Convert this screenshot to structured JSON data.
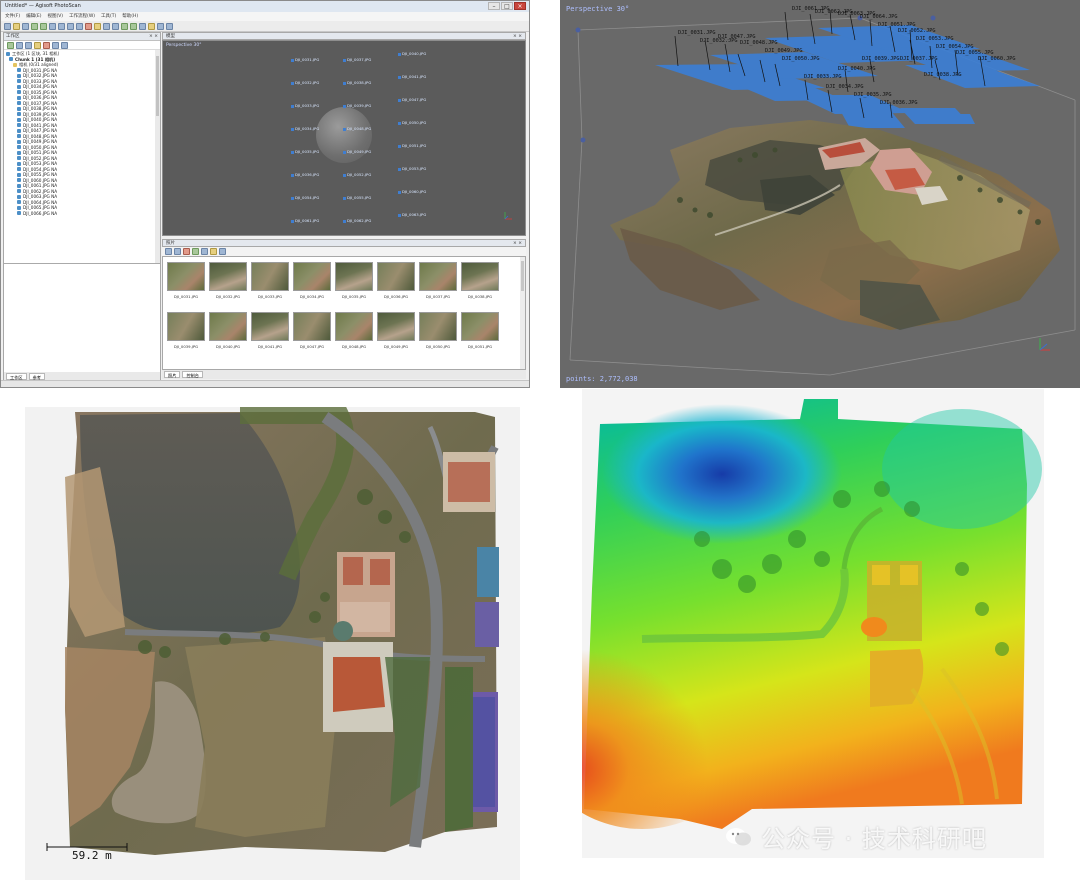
{
  "photoscan": {
    "title": "Untitled* — Agisoft PhotoScan",
    "menu": [
      "文件(F)",
      "编辑(E)",
      "视图(V)",
      "工作流程(W)",
      "工具(T)",
      "帮助(H)"
    ],
    "workspace": {
      "title": "工作区",
      "root": "工作区 (1 区块, 31 相机)",
      "chunk": "Chunk 1 (31 相机)",
      "group": "相机 (0/31 aligned)",
      "cameras": [
        "DJI_0031.JPG NA",
        "DJI_0032.JPG NA",
        "DJI_0033.JPG NA",
        "DJI_0034.JPG NA",
        "DJI_0035.JPG NA",
        "DJI_0036.JPG NA",
        "DJI_0037.JPG NA",
        "DJI_0038.JPG NA",
        "DJI_0039.JPG NA",
        "DJI_0040.JPG NA",
        "DJI_0041.JPG NA",
        "DJI_0047.JPG NA",
        "DJI_0048.JPG NA",
        "DJI_0049.JPG NA",
        "DJI_0050.JPG NA",
        "DJI_0051.JPG NA",
        "DJI_0052.JPG NA",
        "DJI_0053.JPG NA",
        "DJI_0054.JPG NA",
        "DJI_0055.JPG NA",
        "DJI_0060.JPG NA",
        "DJI_0061.JPG NA",
        "DJI_0062.JPG NA",
        "DJI_0063.JPG NA",
        "DJI_0064.JPG NA",
        "DJI_0065.JPG NA",
        "DJI_0066.JPG NA"
      ],
      "tabs": [
        "工作区",
        "参考"
      ]
    },
    "model": {
      "title": "模型",
      "perspective": "Perspective 30°",
      "cams": [
        "DJI_0031.JPG",
        "DJI_0037.JPG",
        "DJI_0040.JPG",
        "DJI_0032.JPG",
        "DJI_0038.JPG",
        "DJI_0041.JPG",
        "DJI_0033.JPG",
        "DJI_0039.JPG",
        "DJI_0047.JPG",
        "DJI_0034.JPG",
        "DJI_0048.JPG",
        "DJI_0050.JPG",
        "DJI_0035.JPG",
        "DJI_0049.JPG",
        "DJI_0051.JPG",
        "DJI_0036.JPG",
        "DJI_0052.JPG",
        "DJI_0053.JPG",
        "DJI_0054.JPG",
        "DJI_0055.JPG",
        "DJI_0060.JPG",
        "DJI_0061.JPG",
        "DJI_0062.JPG",
        "DJI_0063.JPG"
      ]
    },
    "photos": {
      "title": "照片",
      "labels": [
        "DJI_0031.JPG",
        "DJI_0032.JPG",
        "DJI_0033.JPG",
        "DJI_0034.JPG",
        "DJI_0035.JPG",
        "DJI_0036.JPG",
        "DJI_0037.JPG",
        "DJI_0038.JPG",
        "DJI_0039.JPG",
        "DJI_0040.JPG",
        "DJI_0041.JPG",
        "DJI_0047.JPG",
        "DJI_0048.JPG",
        "DJI_0049.JPG",
        "DJI_0050.JPG",
        "DJI_0051.JPG"
      ],
      "tabs": [
        "照片",
        "控制台"
      ]
    }
  },
  "viewer3d": {
    "perspective": "Perspective 30°",
    "points": "points: 2,772,038",
    "cam_labels": [
      "DJI_0061.JPG",
      "DJI_0062.JPG",
      "DJI_0063.JPG",
      "DJI_0064.JPG",
      "DJI_0047.JPG",
      "DJI_0048.JPG",
      "DJI_0049.JPG",
      "DJI_0050.JPG",
      "DJI_0051.JPG",
      "DJI_0052.JPG",
      "DJI_0053.JPG",
      "DJI_0054.JPG",
      "DJI_0055.JPG",
      "DJI_0060.JPG",
      "DJI_0031.JPG",
      "DJI_0032.JPG",
      "DJI_0033.JPG",
      "DJI_0034.JPG",
      "DJI_0035.JPG",
      "DJI_0036.JPG",
      "DJI_0037.JPG",
      "DJI_0038.JPG",
      "DJI_0039.JPG",
      "DJI_0040.JPG"
    ]
  },
  "orthomosaic": {
    "scale_label": "59.2 m"
  },
  "dem": {
    "watermark": "公众号 · 技术科研吧"
  }
}
